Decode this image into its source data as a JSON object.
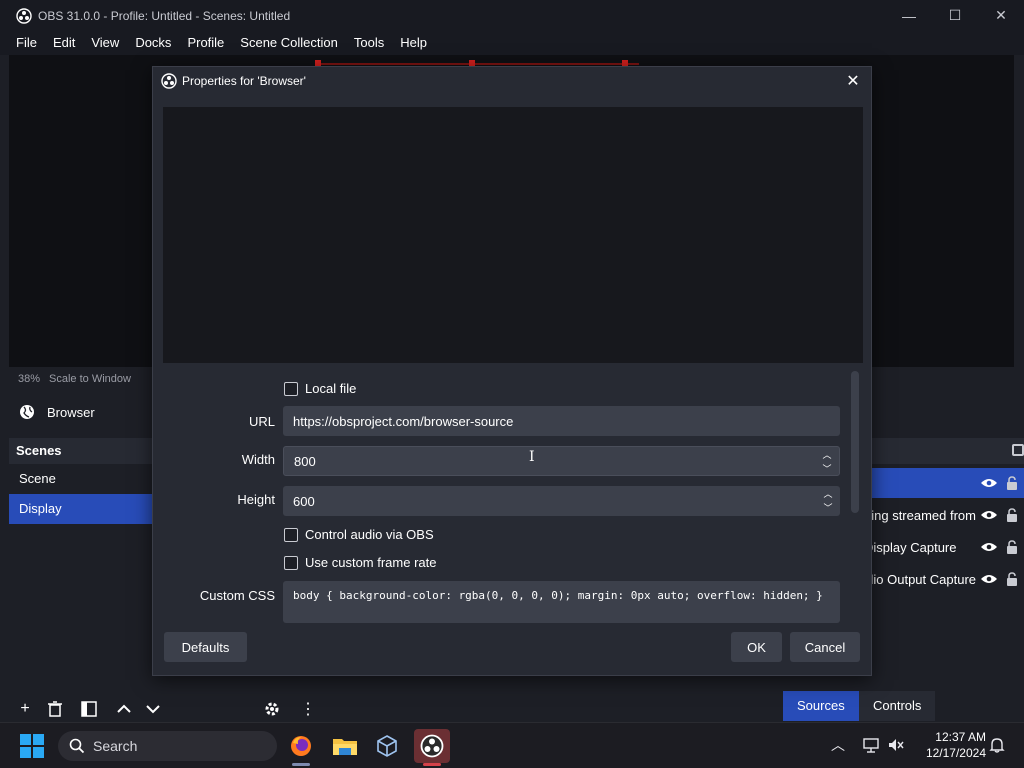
{
  "window": {
    "title": "OBS 31.0.0 - Profile: Untitled - Scenes: Untitled",
    "minimize_symbol": "—",
    "maximize_symbol": "☐",
    "close_symbol": "✕"
  },
  "menu": [
    "File",
    "Edit",
    "View",
    "Docks",
    "Profile",
    "Scene Collection",
    "Tools",
    "Help"
  ],
  "status": {
    "zoom": "38%",
    "scale_mode": "Scale to Window"
  },
  "selected_source": {
    "name": "Browser",
    "icon": "globe-icon"
  },
  "scenes": {
    "header": "Scenes",
    "items": [
      "Scene",
      "Display"
    ],
    "selected_index": 1
  },
  "sources": {
    "items": [
      {
        "label": "",
        "selected": true
      },
      {
        "label": "Currently being streamed from"
      },
      {
        "label": "Display Capture"
      },
      {
        "label": "Audio Output Capture"
      }
    ]
  },
  "bottom_tabs": {
    "sources": "Sources",
    "controls": "Controls"
  },
  "dialog": {
    "title": "Properties for 'Browser'",
    "local_file_label": "Local file",
    "url_label": "URL",
    "url_value": "https://obsproject.com/browser-source",
    "width_label": "Width",
    "width_value": "800",
    "height_label": "Height",
    "height_value": "600",
    "control_audio_label": "Control audio via OBS",
    "custom_frame_rate_label": "Use custom frame rate",
    "custom_css_label": "Custom CSS",
    "custom_css_value": "body { background-color: rgba(0, 0, 0, 0); margin: 0px auto; overflow: hidden; }",
    "defaults_button": "Defaults",
    "ok_button": "OK",
    "cancel_button": "Cancel",
    "spinner_up": "︿",
    "spinner_down": "﹀",
    "close_symbol": "✕"
  },
  "taskbar": {
    "search_placeholder": "Search",
    "time": "12:37 AM",
    "date": "12/17/2024",
    "apps": [
      "firefox-icon",
      "file-explorer-icon",
      "virtualbox-icon",
      "obs-icon"
    ]
  },
  "colors": {
    "accent": "#284cb8",
    "window_bg": "#1d1f26",
    "dialog_bg": "#272a33",
    "input_bg": "#3c404b"
  }
}
